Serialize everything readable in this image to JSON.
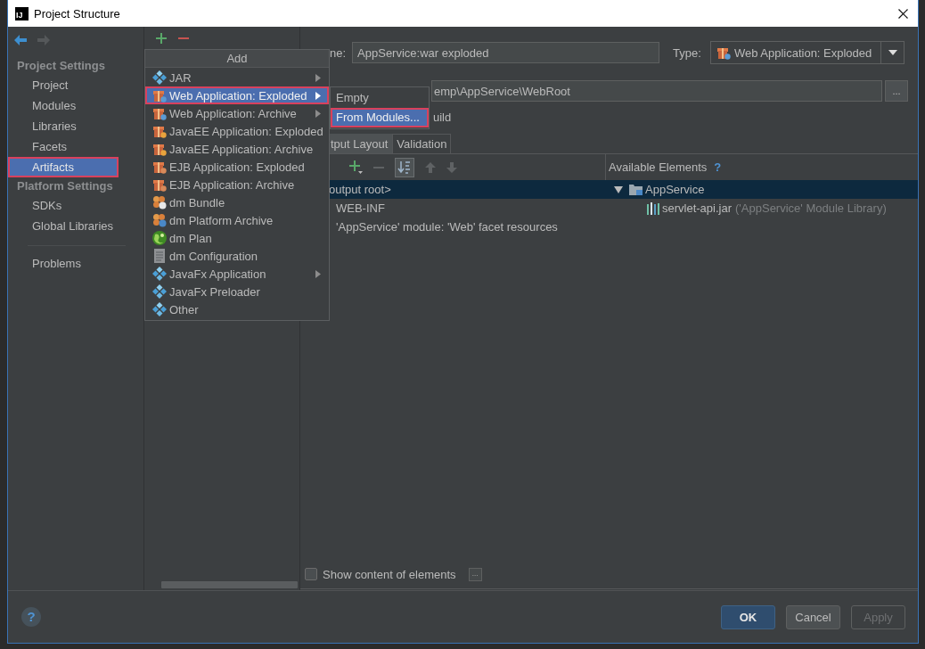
{
  "window": {
    "logo": "IJ",
    "title": "Project Structure"
  },
  "nav": [
    {
      "kind": "back",
      "disabled": false
    },
    {
      "kind": "forward",
      "disabled": true
    }
  ],
  "sidebar": {
    "sections": [
      {
        "title": "Project Settings",
        "items": [
          {
            "label": "Project",
            "selected": false,
            "highlighted": false
          },
          {
            "label": "Modules",
            "selected": false,
            "highlighted": false
          },
          {
            "label": "Libraries",
            "selected": false,
            "highlighted": false
          },
          {
            "label": "Facets",
            "selected": false,
            "highlighted": false
          },
          {
            "label": "Artifacts",
            "selected": true,
            "highlighted": true
          }
        ]
      },
      {
        "title": "Platform Settings",
        "items": [
          {
            "label": "SDKs",
            "selected": false,
            "highlighted": false
          },
          {
            "label": "Global Libraries",
            "selected": false,
            "highlighted": false
          }
        ]
      },
      {
        "items": [
          {
            "label": "Problems",
            "selected": false,
            "highlighted": false
          }
        ]
      }
    ]
  },
  "add_menu": {
    "title": "Add",
    "items": [
      {
        "label": "JAR",
        "kind": "jar",
        "has_submenu": true,
        "selected": false,
        "highlighted": false
      },
      {
        "label": "Web Application: Exploded",
        "kind": "web",
        "has_submenu": true,
        "selected": true,
        "highlighted": true
      },
      {
        "label": "Web Application: Archive",
        "kind": "web",
        "has_submenu": true,
        "selected": false,
        "highlighted": false
      },
      {
        "label": "JavaEE Application: Exploded",
        "kind": "javaee",
        "has_submenu": false,
        "selected": false,
        "highlighted": false
      },
      {
        "label": "JavaEE Application: Archive",
        "kind": "javaee",
        "has_submenu": false,
        "selected": false,
        "highlighted": false
      },
      {
        "label": "EJB Application: Exploded",
        "kind": "ejb",
        "has_submenu": false,
        "selected": false,
        "highlighted": false
      },
      {
        "label": "EJB Application: Archive",
        "kind": "ejb",
        "has_submenu": false,
        "selected": false,
        "highlighted": false
      },
      {
        "label": "dm Bundle",
        "kind": "bundle",
        "has_submenu": false,
        "selected": false,
        "highlighted": false
      },
      {
        "label": "dm Platform Archive",
        "kind": "platform",
        "has_submenu": false,
        "selected": false,
        "highlighted": false
      },
      {
        "label": "dm Plan",
        "kind": "plan",
        "has_submenu": false,
        "selected": false,
        "highlighted": false
      },
      {
        "label": "dm Configuration",
        "kind": "config",
        "has_submenu": false,
        "selected": false,
        "highlighted": false
      },
      {
        "label": "JavaFx Application",
        "kind": "javafx",
        "has_submenu": true,
        "selected": false,
        "highlighted": false
      },
      {
        "label": "JavaFx Preloader",
        "kind": "javafx",
        "has_submenu": false,
        "selected": false,
        "highlighted": false
      },
      {
        "label": "Other",
        "kind": "other",
        "has_submenu": false,
        "selected": false,
        "highlighted": false
      }
    ]
  },
  "submenu": {
    "items": [
      {
        "label": "Empty",
        "selected": false,
        "highlighted": false
      },
      {
        "label": "From Modules...",
        "selected": true,
        "highlighted": true
      }
    ]
  },
  "name_field": {
    "label": "ne:",
    "value": "AppService:war exploded"
  },
  "type_field": {
    "label": "Type:",
    "value": "Web Application: Exploded"
  },
  "output_directory": {
    "value": "emp\\AppService\\WebRoot",
    "button": "..."
  },
  "build_option": {
    "label": "uild"
  },
  "tabs": [
    {
      "label": "tput Layout",
      "selected": true
    },
    {
      "label": "Validation",
      "selected": false
    }
  ],
  "layout_toolbar": [
    {
      "kind": "add",
      "disabled": false,
      "on": false
    },
    {
      "kind": "remove",
      "disabled": true,
      "on": false
    },
    {
      "kind": "sort",
      "disabled": false,
      "on": true
    },
    {
      "kind": "up",
      "disabled": true,
      "on": false
    },
    {
      "kind": "down",
      "disabled": true,
      "on": false
    }
  ],
  "layout_tree": [
    {
      "label": "output root>",
      "selected": true,
      "children": [
        {
          "label": "WEB-INF",
          "selected": false
        },
        {
          "label": "'AppService' module: 'Web' facet resources",
          "selected": false
        }
      ]
    }
  ],
  "available_elements": {
    "title": "Available Elements",
    "help": "?",
    "tree": [
      {
        "label": "AppService",
        "expanded": true,
        "selected": true,
        "children": [
          {
            "label": "servlet-api.jar",
            "note": "('AppService' Module Library)",
            "selected": false
          }
        ]
      }
    ]
  },
  "show_content": {
    "label": "Show content of elements",
    "checked": false,
    "button": "..."
  },
  "footer": {
    "help": "?",
    "buttons": [
      {
        "label": "OK",
        "kind": "primary",
        "disabled": false
      },
      {
        "label": "Cancel",
        "kind": "normal",
        "disabled": false
      },
      {
        "label": "Apply",
        "kind": "normal",
        "disabled": true
      }
    ]
  }
}
